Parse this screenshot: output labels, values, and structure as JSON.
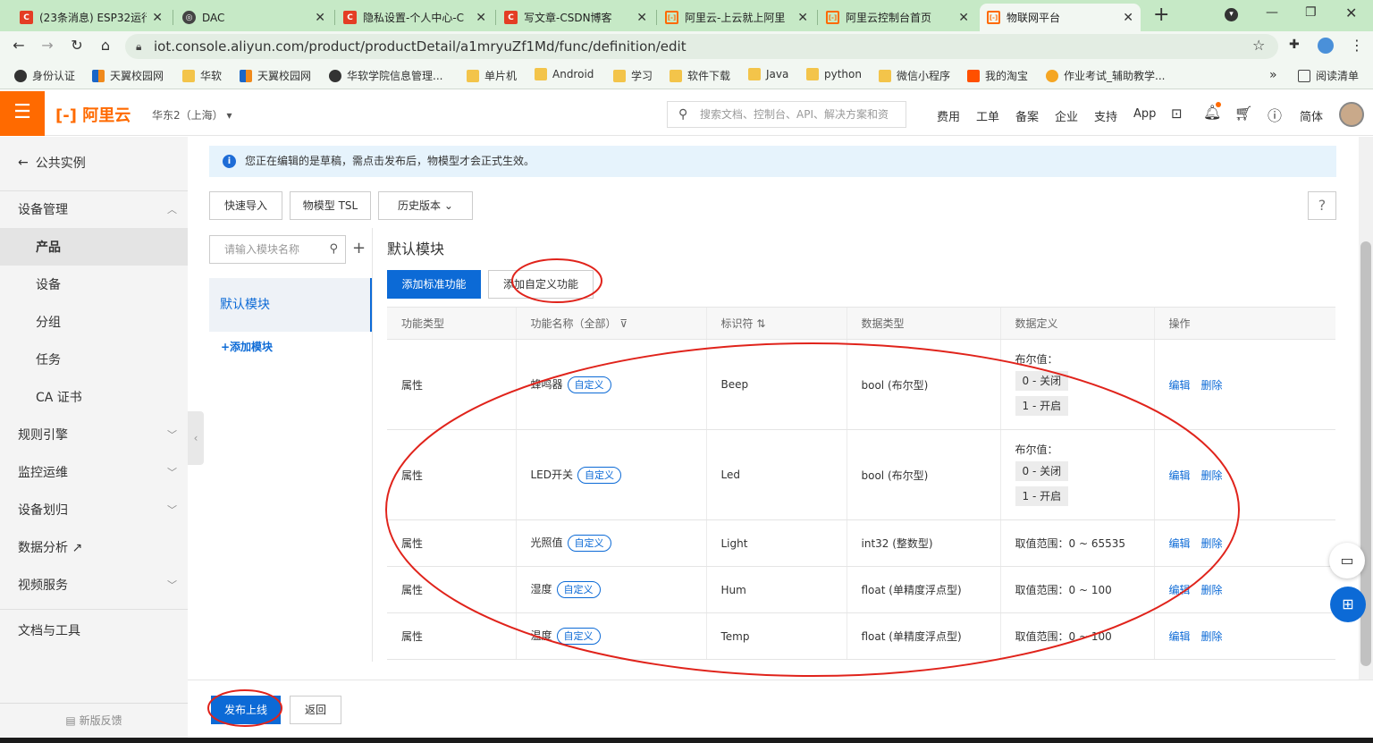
{
  "browser": {
    "tabs": [
      {
        "title": "(23条消息) ESP32运行",
        "icon": "csdn-icon"
      },
      {
        "title": "DAC",
        "icon": "globe-icon"
      },
      {
        "title": "隐私设置-个人中心-C",
        "icon": "csdn-icon"
      },
      {
        "title": "写文章-CSDN博客",
        "icon": "csdn-icon"
      },
      {
        "title": "阿里云-上云就上阿里",
        "icon": "aliyun-icon"
      },
      {
        "title": "阿里云控制台首页",
        "icon": "aliyun-icon"
      },
      {
        "title": "物联网平台",
        "icon": "aliyun-icon"
      }
    ],
    "url": "iot.console.aliyun.com/product/productDetail/a1mryuZf1Md/func/definition/edit",
    "bookmarks": [
      "身份认证",
      "天翼校园网",
      "华软",
      "天翼校园网",
      "华软学院信息管理...",
      "单片机",
      "Android",
      "学习",
      "软件下载",
      "Java",
      "python",
      "微信小程序",
      "我的淘宝",
      "作业考试_辅助教学..."
    ],
    "reading_list": "阅读清单"
  },
  "header": {
    "logo": "阿里云",
    "region": "华东2（上海）",
    "search_placeholder": "搜索文档、控制台、API、解决方案和资",
    "links": [
      "费用",
      "工单",
      "备案",
      "企业",
      "支持",
      "App"
    ],
    "lang": "简体"
  },
  "sidebar": {
    "back": "公共实例",
    "items": [
      {
        "label": "设备管理",
        "chev": "up"
      },
      {
        "label": "产品",
        "selected": true
      },
      {
        "label": "设备"
      },
      {
        "label": "分组"
      },
      {
        "label": "任务"
      },
      {
        "label": "CA 证书"
      },
      {
        "label": "规则引擎",
        "chev": "down"
      },
      {
        "label": "监控运维",
        "chev": "down"
      },
      {
        "label": "设备划归",
        "chev": "down"
      },
      {
        "label": "数据分析 ↗"
      },
      {
        "label": "视频服务",
        "chev": "down"
      },
      {
        "label": "文档与工具"
      }
    ],
    "feedback": "新版反馈"
  },
  "content": {
    "notice": "您正在编辑的是草稿，需点击发布后，物模型才会正式生效。",
    "toolbar": {
      "quick_import": "快速导入",
      "tsl": "物模型 TSL",
      "history": "历史版本"
    },
    "module_search_placeholder": "请输入模块名称",
    "default_module": "默认模块",
    "add_module": "+添加模块",
    "module_title": "默认模块",
    "add_standard": "添加标准功能",
    "add_custom": "添加自定义功能",
    "table": {
      "headers": [
        "功能类型",
        "功能名称（全部）",
        "标识符",
        "数据类型",
        "数据定义",
        "操作"
      ],
      "rows": [
        {
          "type": "属性",
          "name": "蜂鸣器",
          "tag": "自定义",
          "id": "Beep",
          "dtype": "bool (布尔型)",
          "def_label": "布尔值：",
          "def_values": [
            "0 - 关闭",
            "1 - 开启"
          ],
          "edit": "编辑",
          "delete": "删除"
        },
        {
          "type": "属性",
          "name": "LED开关",
          "tag": "自定义",
          "id": "Led",
          "dtype": "bool (布尔型)",
          "def_label": "布尔值：",
          "def_values": [
            "0 - 关闭",
            "1 - 开启"
          ],
          "edit": "编辑",
          "delete": "删除"
        },
        {
          "type": "属性",
          "name": "光照值",
          "tag": "自定义",
          "id": "Light",
          "dtype": "int32 (整数型)",
          "def_text": "取值范围：0 ~ 65535",
          "edit": "编辑",
          "delete": "删除"
        },
        {
          "type": "属性",
          "name": "湿度",
          "tag": "自定义",
          "id": "Hum",
          "dtype": "float (单精度浮点型)",
          "def_text": "取值范围：0 ~ 100",
          "edit": "编辑",
          "delete": "删除"
        },
        {
          "type": "属性",
          "name": "温度",
          "tag": "自定义",
          "id": "Temp",
          "dtype": "float (单精度浮点型)",
          "def_text": "取值范围：0 ~ 100",
          "edit": "编辑",
          "delete": "删除"
        }
      ]
    },
    "publish": "发布上线",
    "back": "返回"
  },
  "colors": {
    "accent": "#0c6ad6",
    "brand": "#ff6a00",
    "annotation": "#e0231b"
  }
}
